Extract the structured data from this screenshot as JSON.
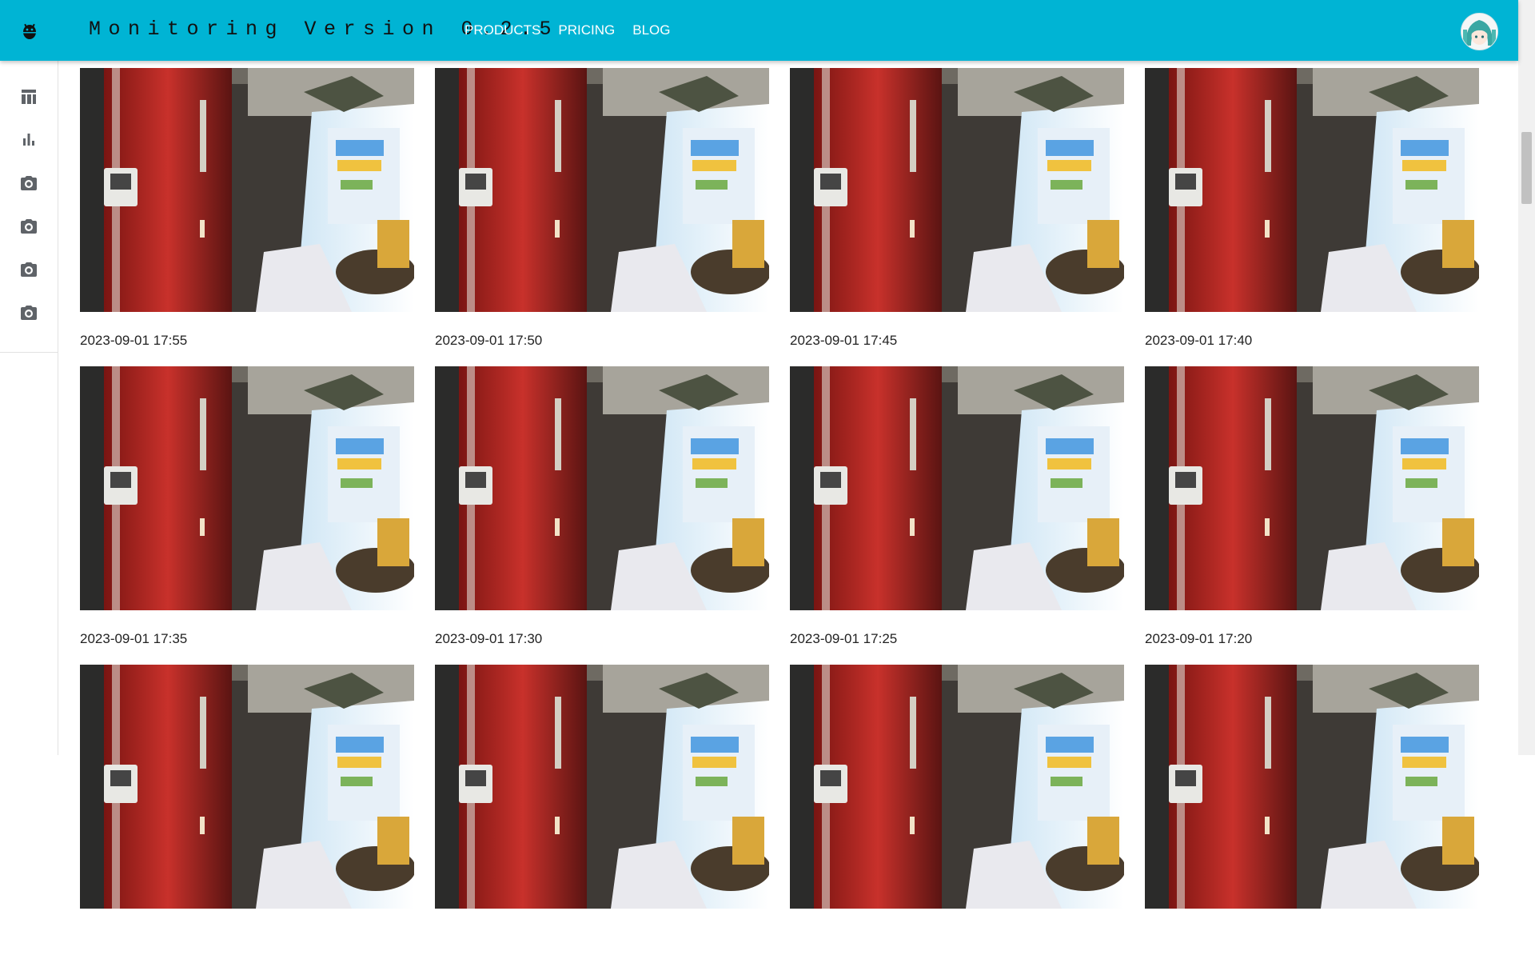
{
  "header": {
    "title": "Monitoring Version 0.2.5",
    "nav": [
      "PRODUCTS",
      "PRICING",
      "BLOG"
    ],
    "logo_icon": "android-icon",
    "avatar": "user-avatar"
  },
  "sidebar": {
    "items": [
      {
        "icon": "table-icon"
      },
      {
        "icon": "bar-chart-icon"
      },
      {
        "icon": "camera-icon"
      },
      {
        "icon": "camera-icon"
      },
      {
        "icon": "camera-icon"
      },
      {
        "icon": "camera-icon"
      }
    ]
  },
  "gallery": {
    "captions": [
      "2023-09-01 17:55",
      "2023-09-01 17:50",
      "2023-09-01 17:45",
      "2023-09-01 17:40",
      "2023-09-01 17:35",
      "2023-09-01 17:30",
      "2023-09-01 17:25",
      "2023-09-01 17:20",
      "",
      "",
      "",
      ""
    ]
  },
  "colors": {
    "appbar": "#00b4d4",
    "nav_text": "#ffffff",
    "icon_gray": "#5f6368"
  }
}
